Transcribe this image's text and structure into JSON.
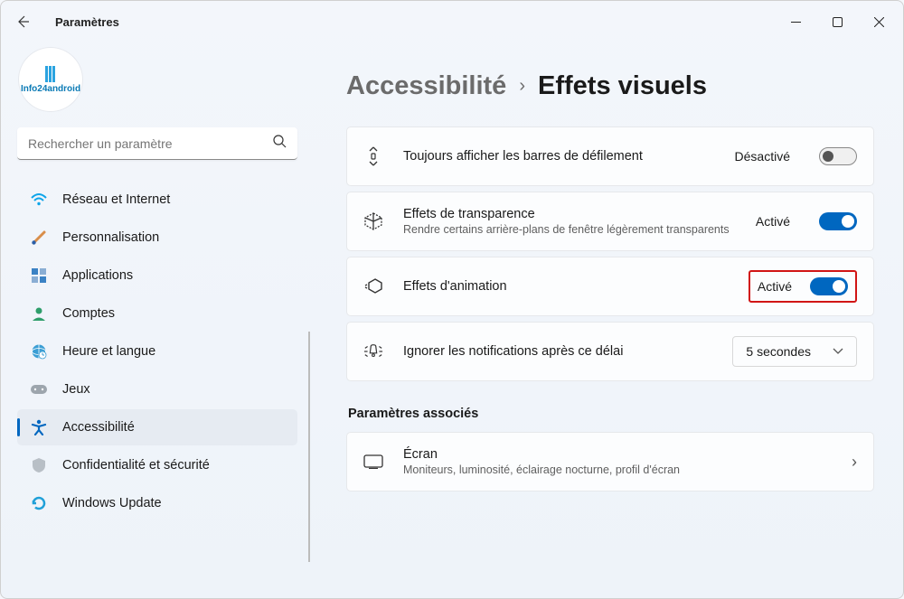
{
  "app": {
    "title": "Paramètres"
  },
  "sidebar": {
    "avatar_text": "Info24android",
    "search_placeholder": "Rechercher un paramètre",
    "items": [
      {
        "label": "Réseau et Internet"
      },
      {
        "label": "Personnalisation"
      },
      {
        "label": "Applications"
      },
      {
        "label": "Comptes"
      },
      {
        "label": "Heure et langue"
      },
      {
        "label": "Jeux"
      },
      {
        "label": "Accessibilité"
      },
      {
        "label": "Confidentialité et sécurité"
      },
      {
        "label": "Windows Update"
      }
    ]
  },
  "breadcrumb": {
    "parent": "Accessibilité",
    "current": "Effets visuels"
  },
  "settings": {
    "scrollbars": {
      "title": "Toujours afficher les barres de défilement",
      "status": "Désactivé"
    },
    "transparency": {
      "title": "Effets de transparence",
      "sub": "Rendre certains arrière-plans de fenêtre légèrement transparents",
      "status": "Activé"
    },
    "animation": {
      "title": "Effets d'animation",
      "status": "Activé"
    },
    "notifications": {
      "title": "Ignorer les notifications après ce délai",
      "value": "5 secondes"
    }
  },
  "related": {
    "heading": "Paramètres associés",
    "screen": {
      "title": "Écran",
      "sub": "Moniteurs, luminosité, éclairage nocturne, profil d'écran"
    }
  }
}
